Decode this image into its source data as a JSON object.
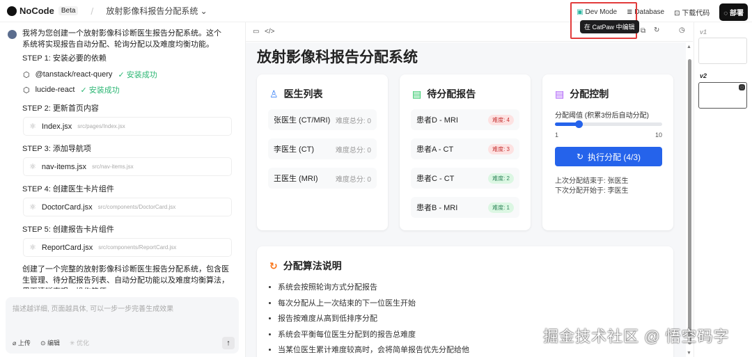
{
  "header": {
    "brand": "NoCode",
    "beta": "Beta",
    "project": "放射影像科报告分配系统",
    "dev_mode": "Dev Mode",
    "database": "Database",
    "download": "下载代码",
    "deploy": "部署",
    "tooltip": "在 CatPaw 中编辑"
  },
  "chat": {
    "intro": "我将为您创建一个放射影像科诊断医生报告分配系统。这个系统将实现报告自动分配、轮询分配以及难度均衡功能。",
    "step1": "STEP 1: 安装必要的依赖",
    "deps": [
      {
        "name": "@tanstack/react-query",
        "status": "安装成功"
      },
      {
        "name": "lucide-react",
        "status": "安装成功"
      }
    ],
    "steps": [
      {
        "title": "STEP 2: 更新首页内容",
        "file": "Index.jsx",
        "path": "src/pages/Index.jsx"
      },
      {
        "title": "STEP 3: 添加导航项",
        "file": "nav-items.jsx",
        "path": "src/nav-items.jsx"
      },
      {
        "title": "STEP 4: 创建医生卡片组件",
        "file": "DoctorCard.jsx",
        "path": "src/components/DoctorCard.jsx"
      },
      {
        "title": "STEP 5: 创建报告卡片组件",
        "file": "ReportCard.jsx",
        "path": "src/components/ReportCard.jsx"
      }
    ],
    "summary": "创建了一个完整的放射影像科诊断医生报告分配系统，包含医生管理、待分配报告列表、自动分配功能以及难度均衡算法，界面清晰直观，操作简便。",
    "placeholder": "描述越详细, 页面越具体, 可以一步一步完善生成效果",
    "upload": "上传",
    "edit": "编辑",
    "optimize": "优化"
  },
  "preview": {
    "title": "放射影像科报告分配系统",
    "doctors_title": "医生列表",
    "doctors": [
      {
        "name": "张医生 (CT/MRI)",
        "score": "难度总分: 0"
      },
      {
        "name": "李医生 (CT)",
        "score": "难度总分: 0"
      },
      {
        "name": "王医生 (MRI)",
        "score": "难度总分: 0"
      }
    ],
    "reports_title": "待分配报告",
    "reports": [
      {
        "name": "患者D - MRI",
        "diff": "难度: 4"
      },
      {
        "name": "患者A - CT",
        "diff": "难度: 3"
      },
      {
        "name": "患者C - CT",
        "diff": "难度: 2"
      },
      {
        "name": "患者B - MRI",
        "diff": "难度: 1"
      }
    ],
    "control_title": "分配控制",
    "threshold_label": "分配阈值 (积累3份后自动分配)",
    "slider_min": "1",
    "slider_max": "10",
    "slider_value": 3,
    "run_button": "执行分配 (4/3)",
    "last_end": "上次分配结束于: 张医生",
    "next_start": "下次分配开始于: 李医生",
    "algo_title": "分配算法说明",
    "algo": [
      "系统会按照轮询方式分配报告",
      "每次分配从上一次结束的下一位医生开始",
      "报告按难度从高到低排序分配",
      "系统会平衡每位医生分配到的报告总难度",
      "当某位医生累计难度较高时，会将简单报告优先分配给他"
    ]
  },
  "versions": [
    "v1",
    "v2"
  ],
  "watermark": "掘金技术社区 @ 悟空码字"
}
